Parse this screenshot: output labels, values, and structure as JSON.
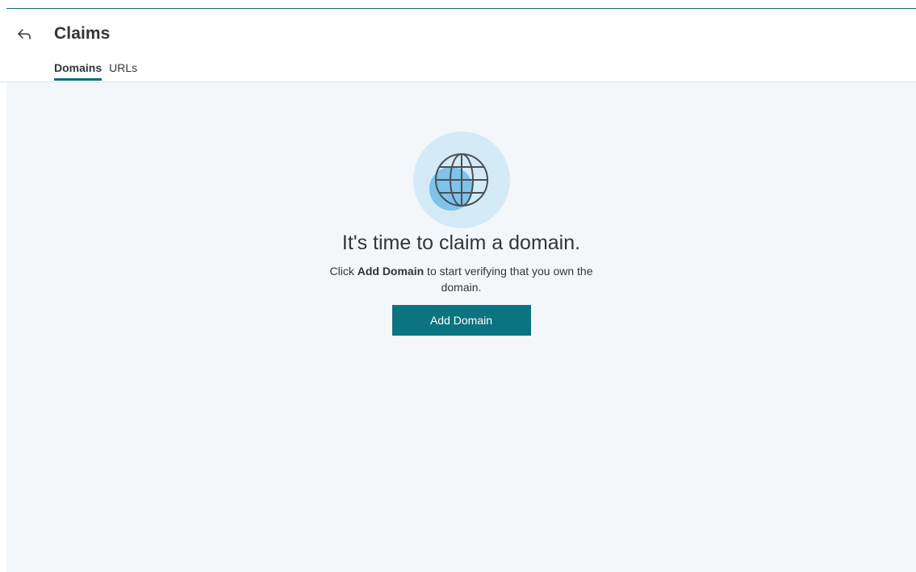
{
  "header": {
    "back_icon": "back-arrow-icon",
    "title": "Claims"
  },
  "tabs": [
    {
      "label": "Domains",
      "active": true
    },
    {
      "label": "URLs",
      "active": false
    }
  ],
  "empty_state": {
    "illustration_icon": "globe-icon",
    "title": "It's time to claim a domain.",
    "description_prefix": "Click ",
    "description_bold": "Add Domain",
    "description_suffix": " to start verifying that you own the domain.",
    "button_label": "Add Domain"
  },
  "colors": {
    "accent": "#0b7480",
    "background": "#f4f7fa",
    "illustration_circle": "#d4eaf6",
    "illustration_shadow": "#7fc2ea"
  }
}
